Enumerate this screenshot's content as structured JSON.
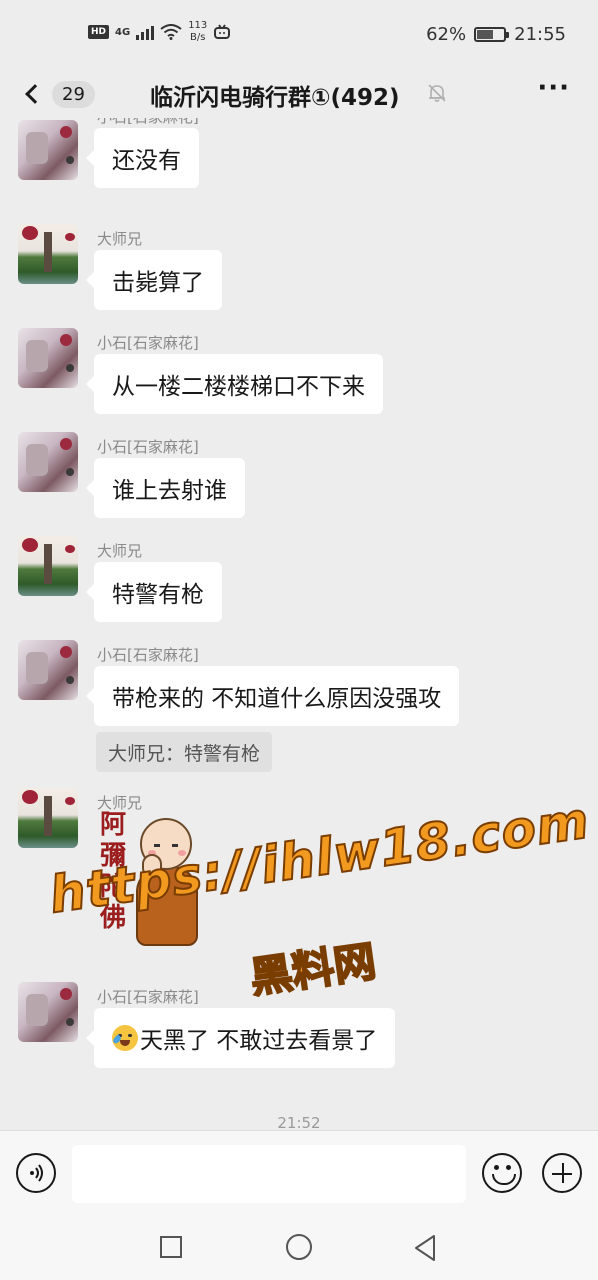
{
  "status_bar": {
    "hd": "HD",
    "network": "4G",
    "speed_value": "113",
    "speed_unit": "B/s",
    "battery": "62%",
    "battery_level": 0.62,
    "time": "21:55"
  },
  "nav": {
    "unread_count": "29",
    "title": "临沂闪电骑行群①(492)",
    "more_label": "···"
  },
  "messages": [
    {
      "sender": "小石[石家麻花]",
      "text": "还没有",
      "avatar": "stone"
    },
    {
      "sender": "大师兄",
      "text": "击毙算了",
      "avatar": "pagoda"
    },
    {
      "sender": "小石[石家麻花]",
      "text": "从一楼二楼楼梯口不下来",
      "avatar": "stone"
    },
    {
      "sender": "小石[石家麻花]",
      "text": "谁上去射谁",
      "avatar": "stone"
    },
    {
      "sender": "大师兄",
      "text": "特警有枪",
      "avatar": "pagoda"
    },
    {
      "sender": "小石[石家麻花]",
      "text": "带枪来的 不知道什么原因没强攻",
      "avatar": "stone",
      "quote": "大师兄：特警有枪"
    },
    {
      "sender": "大师兄",
      "sticker_text": "阿彌陀佛",
      "avatar": "pagoda"
    },
    {
      "sender": "小石[石家麻花]",
      "text": "天黑了 不敢过去看景了",
      "avatar": "stone",
      "emoji": "crying-laughing"
    }
  ],
  "watermark": {
    "line1": "https://ihlw18.com",
    "line2": "黑料网"
  },
  "time_divider": "21:52",
  "input": {
    "placeholder": ""
  }
}
